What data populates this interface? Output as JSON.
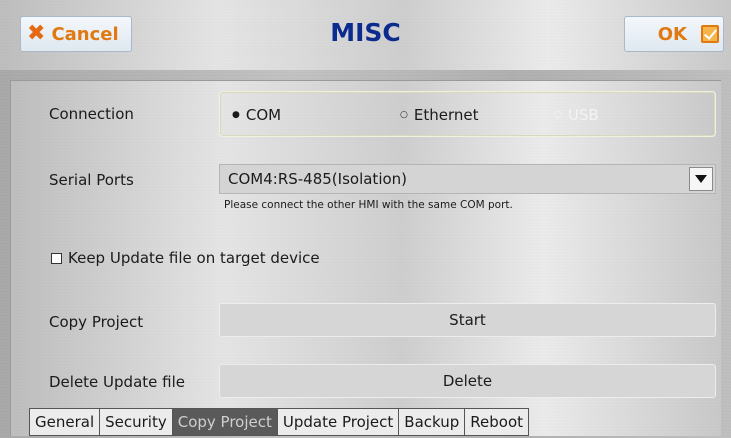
{
  "header": {
    "cancel_label": "Cancel",
    "title": "MISC",
    "ok_label": "OK"
  },
  "connection": {
    "label": "Connection",
    "options": [
      {
        "label": "COM",
        "selected": true,
        "enabled": true
      },
      {
        "label": "Ethernet",
        "selected": false,
        "enabled": true
      },
      {
        "label": "USB",
        "selected": false,
        "enabled": false
      }
    ]
  },
  "serial_ports": {
    "label": "Serial Ports",
    "value": "COM4:RS-485(Isolation)",
    "hint": "Please connect the other HMI with the same COM port."
  },
  "keep_update": {
    "label": "Keep Update file on target device",
    "checked": false
  },
  "copy_project": {
    "label": "Copy Project",
    "button": "Start"
  },
  "delete_update": {
    "label": "Delete Update file",
    "button": "Delete"
  },
  "tabs": [
    {
      "label": "General",
      "active": false
    },
    {
      "label": "Security",
      "active": false
    },
    {
      "label": "Copy Project",
      "active": true
    },
    {
      "label": "Update Project",
      "active": false
    },
    {
      "label": "Backup",
      "active": false
    },
    {
      "label": "Reboot",
      "active": false
    }
  ],
  "colors": {
    "accent": "#e07a10",
    "title": "#0b2b8f"
  }
}
